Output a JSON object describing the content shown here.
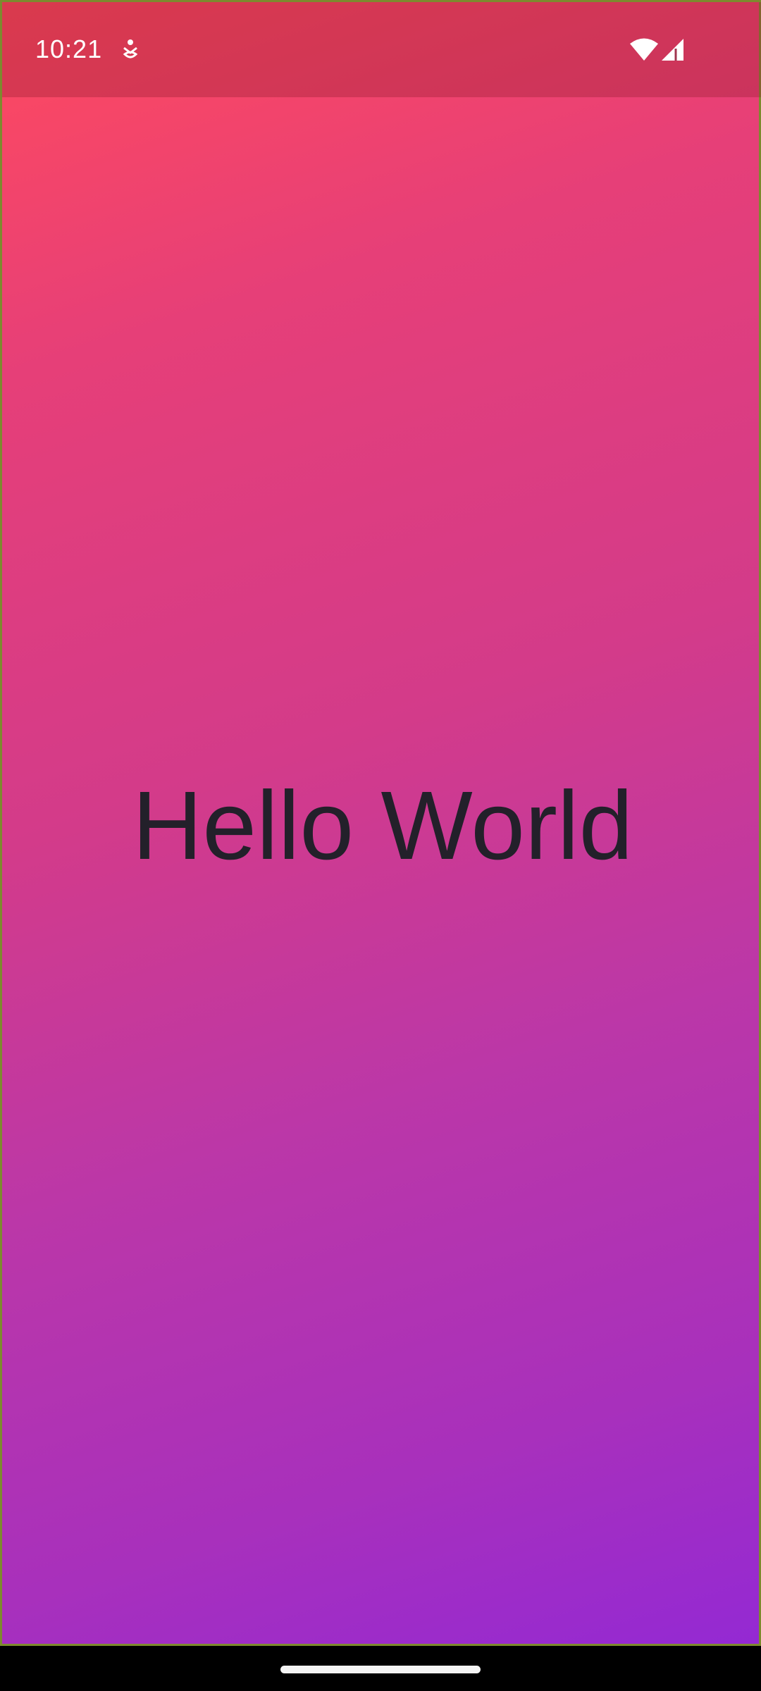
{
  "status_bar": {
    "time": "10:21",
    "notification_icon": "accessibility-person-icon",
    "wifi_icon": "wifi-icon",
    "signal_icon": "cell-signal-icon"
  },
  "main": {
    "greeting": "Hello World"
  },
  "colors": {
    "gradient_top_left": "#ff4a5e",
    "gradient_bottom_right": "#9429d3",
    "text": "#23202a"
  }
}
